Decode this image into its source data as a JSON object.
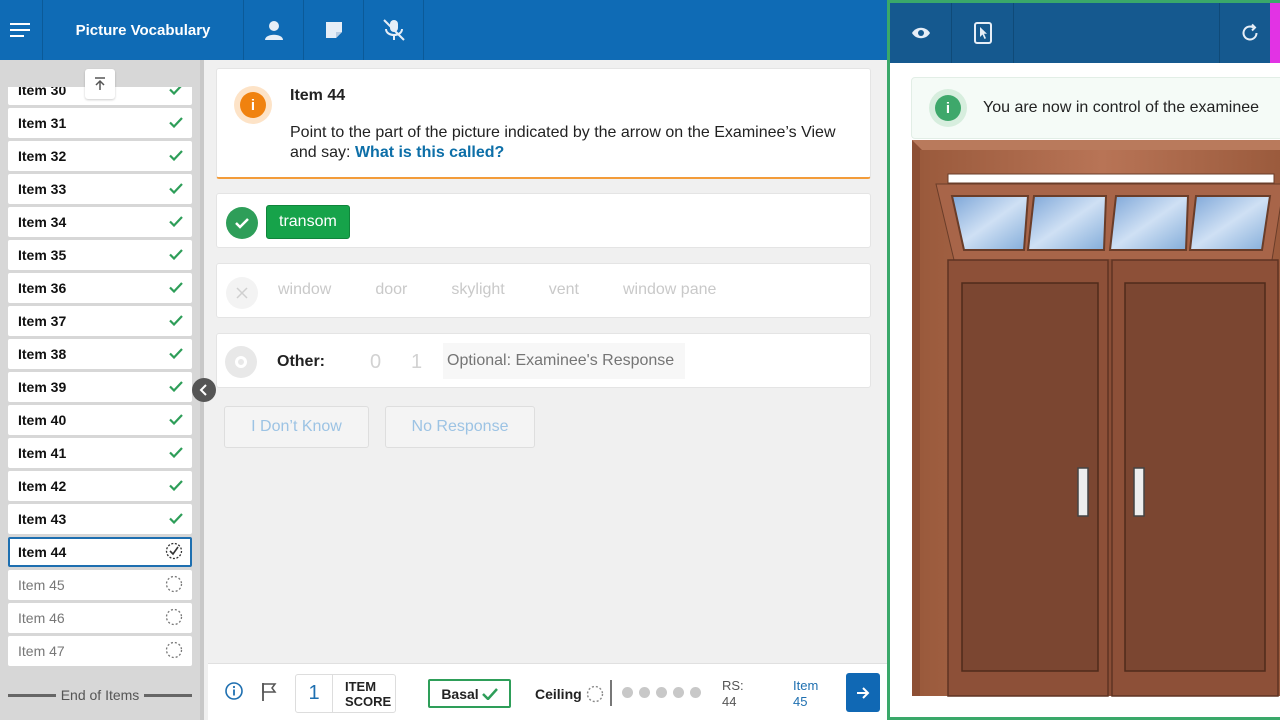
{
  "app": {
    "title": "Picture Vocabulary"
  },
  "sidebar": {
    "items": [
      {
        "label": "Item 30",
        "status": "done"
      },
      {
        "label": "Item 31",
        "status": "done"
      },
      {
        "label": "Item 32",
        "status": "done"
      },
      {
        "label": "Item 33",
        "status": "done"
      },
      {
        "label": "Item 34",
        "status": "done"
      },
      {
        "label": "Item 35",
        "status": "done"
      },
      {
        "label": "Item 36",
        "status": "done"
      },
      {
        "label": "Item 37",
        "status": "done"
      },
      {
        "label": "Item 38",
        "status": "done"
      },
      {
        "label": "Item 39",
        "status": "done"
      },
      {
        "label": "Item 40",
        "status": "done"
      },
      {
        "label": "Item 41",
        "status": "done"
      },
      {
        "label": "Item 42",
        "status": "done"
      },
      {
        "label": "Item 43",
        "status": "done"
      },
      {
        "label": "Item 44",
        "status": "current"
      },
      {
        "label": "Item 45",
        "status": "pending"
      },
      {
        "label": "Item 46",
        "status": "pending"
      },
      {
        "label": "Item 47",
        "status": "pending"
      }
    ],
    "end_label": "End of Items"
  },
  "prompt": {
    "title": "Item 44",
    "instruction": "Point to the part of the picture indicated by the arrow on the Examinee’s View and say:",
    "question": "What is this called?"
  },
  "correct": {
    "answer": "transom"
  },
  "incorrect": {
    "options": [
      "window",
      "door",
      "skylight",
      "vent",
      "window pane"
    ]
  },
  "other": {
    "label": "Other:",
    "score0": "0",
    "score1": "1",
    "placeholder": "Optional: Examinee's Response"
  },
  "buttons": {
    "dont_know": "I Don’t Know",
    "no_response": "No Response"
  },
  "bottom": {
    "item_score_value": "1",
    "item_score_line1": "ITEM",
    "item_score_line2": "SCORE",
    "basal_label": "Basal",
    "ceiling_label": "Ceiling",
    "rs_label": "RS:",
    "rs_value": "44",
    "next_item_label": "Item",
    "next_item_value": "45"
  },
  "examinee_panel": {
    "notice": "You are now in control of the examinee"
  },
  "colors": {
    "primary_blue": "#0f6bb5",
    "panel_blue": "#15598f",
    "success_green": "#16a34a",
    "alert_orange": "#f0820f",
    "panel_border_green": "#3aa86a",
    "accent_magenta": "#e233e4"
  }
}
